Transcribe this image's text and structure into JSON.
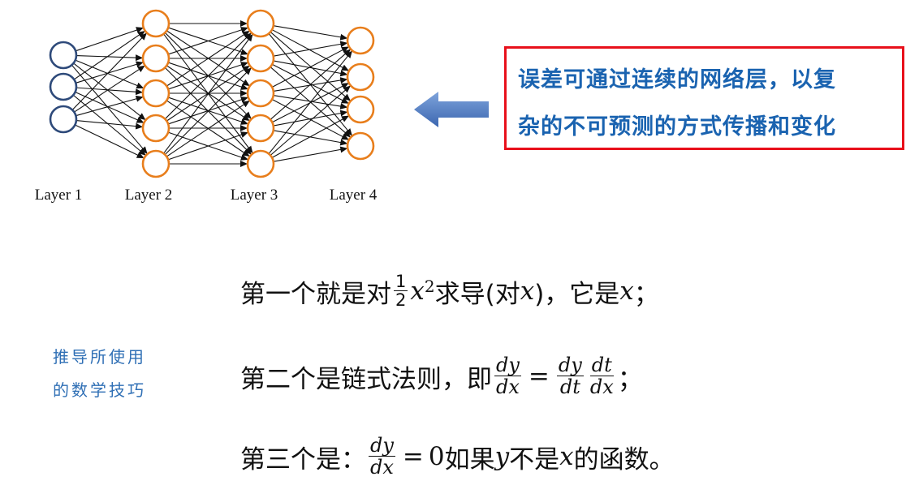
{
  "diagram": {
    "layers": [
      {
        "label": "Layer 1",
        "neurons": 3,
        "color": "#2e4a7a"
      },
      {
        "label": "Layer 2",
        "neurons": 5,
        "color": "#e87e1c"
      },
      {
        "label": "Layer 3",
        "neurons": 5,
        "color": "#e87e1c"
      },
      {
        "label": "Layer 4",
        "neurons": 4,
        "color": "#e87e1c"
      }
    ],
    "arrow_color": "#4a78c0"
  },
  "callout": {
    "line1": "误差可通过连续的网络层，以复",
    "line2": "杂的不可预测的方式传播和变化",
    "border_color": "#e8101b",
    "text_color": "#1a63b0"
  },
  "side_note": {
    "line1": "推导所使用",
    "line2": "的数学技巧",
    "color": "#2f6fb5"
  },
  "equations": {
    "eq1": {
      "prefix": "第一个就是对",
      "frac_num": "1",
      "frac_den": "2",
      "var_x": "x",
      "exponent": "2",
      "middle": "求导(对",
      "var_x2": "x",
      "close": ")，它是",
      "var_x3": "x",
      "end": "；"
    },
    "eq2": {
      "prefix": "第二个是链式法则，即",
      "f1_num": "dy",
      "f1_den": "dx",
      "eq_sign": "=",
      "f2_num": "dy",
      "f2_den": "dt",
      "f3_num": "dt",
      "f3_den": "dx",
      "end": "；"
    },
    "eq3": {
      "prefix": "第三个是：",
      "f_num": "dy",
      "f_den": "dx",
      "eq_sign": "=",
      "zero": "0",
      "if": "如果",
      "var_y": "y",
      "not": "不是",
      "var_x": "x",
      "end": "的函数。"
    }
  }
}
